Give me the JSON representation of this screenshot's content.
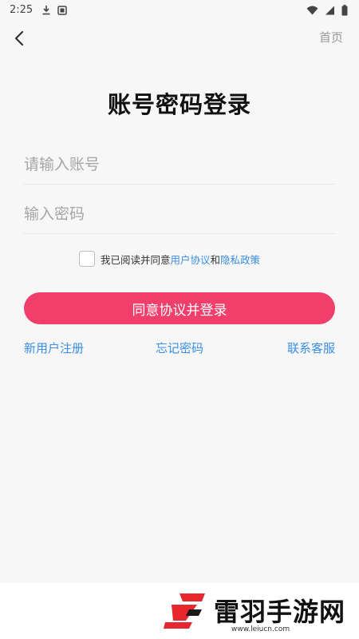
{
  "status_bar": {
    "time": "2:25",
    "icons": [
      "download-icon",
      "photo-icon",
      "wifi-icon",
      "cellular-signal-icon",
      "battery-icon"
    ]
  },
  "nav": {
    "back_icon": "back-arrow-icon",
    "home_label": "首页"
  },
  "title": "账号密码登录",
  "form": {
    "account_placeholder": "请输入账号",
    "account_value": "",
    "password_placeholder": "输入密码",
    "password_value": ""
  },
  "agreement": {
    "checked": false,
    "prefix": "我已阅读并同意",
    "user_agreement": "用户协议",
    "conjunction": "和",
    "privacy_policy": "隐私政策"
  },
  "login_button_label": "同意协议并登录",
  "links": {
    "register": "新用户注册",
    "forgot_password": "忘记密码",
    "customer_service": "联系客服"
  },
  "watermark": {
    "name": "雷羽手游网",
    "url": "www.leiucn.com"
  },
  "colors": {
    "accent": "#ef3f6a",
    "link": "#3a8ee6",
    "background": "#f7f7f7"
  }
}
